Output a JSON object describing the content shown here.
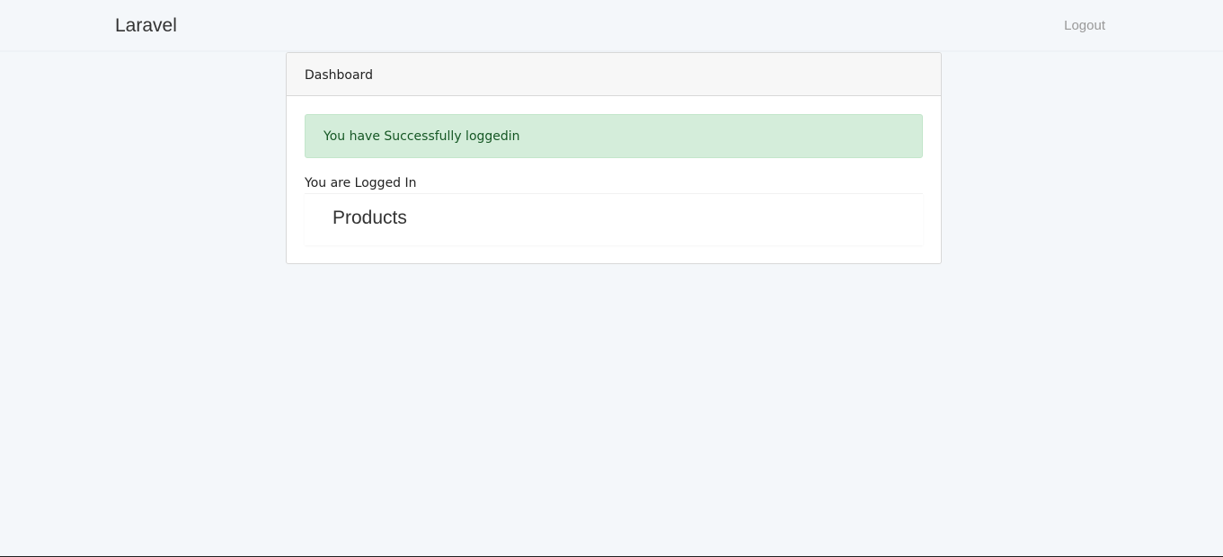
{
  "navbar": {
    "brand": "Laravel",
    "logout_label": "Logout"
  },
  "card": {
    "header_title": "Dashboard",
    "alert_message": "You have Successfully loggedin",
    "status_text": "You are Logged In",
    "products_label": "Products"
  },
  "colors": {
    "page_background": "#f4f7fa",
    "card_header_background": "#f7f7f7",
    "alert_background": "#d4edda",
    "alert_text": "#155724",
    "logout_text": "#999999"
  }
}
